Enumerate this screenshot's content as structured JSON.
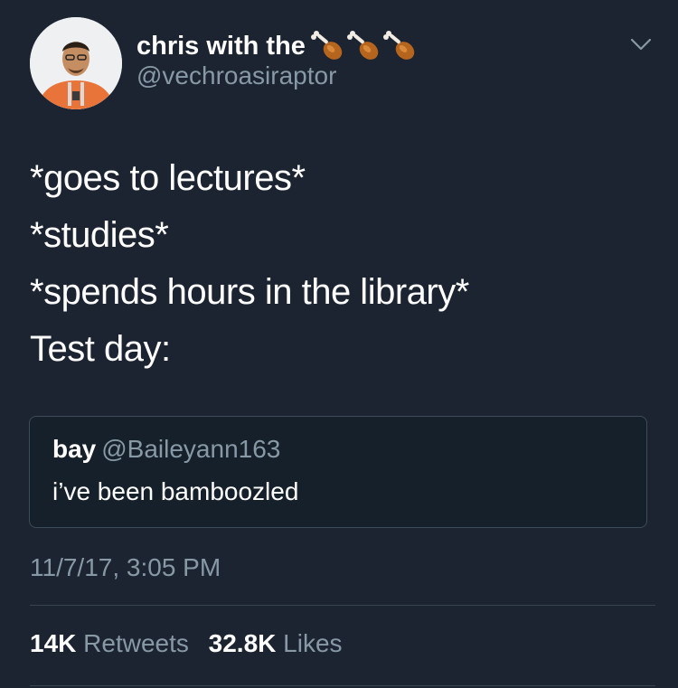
{
  "author": {
    "name": "chris with the",
    "emojis": [
      "drumstick-icon",
      "drumstick-icon",
      "drumstick-icon"
    ],
    "handle": "@vechroasiraptor"
  },
  "tweet": {
    "lines": [
      "*goes to lectures*",
      "*studies*",
      "*spends hours in the library*",
      "Test day:"
    ]
  },
  "quote": {
    "name": "bay",
    "handle": "@Baileyann163",
    "text": "i’ve been bamboozled"
  },
  "timestamp": "11/7/17, 3:05 PM",
  "stats": {
    "retweets_count": "14K",
    "retweets_label": "Retweets",
    "likes_count": "32.8K",
    "likes_label": "Likes"
  },
  "colors": {
    "background": "#1c2431",
    "secondary_text": "#8899a6",
    "avatar_shirt": "#e8743a"
  }
}
